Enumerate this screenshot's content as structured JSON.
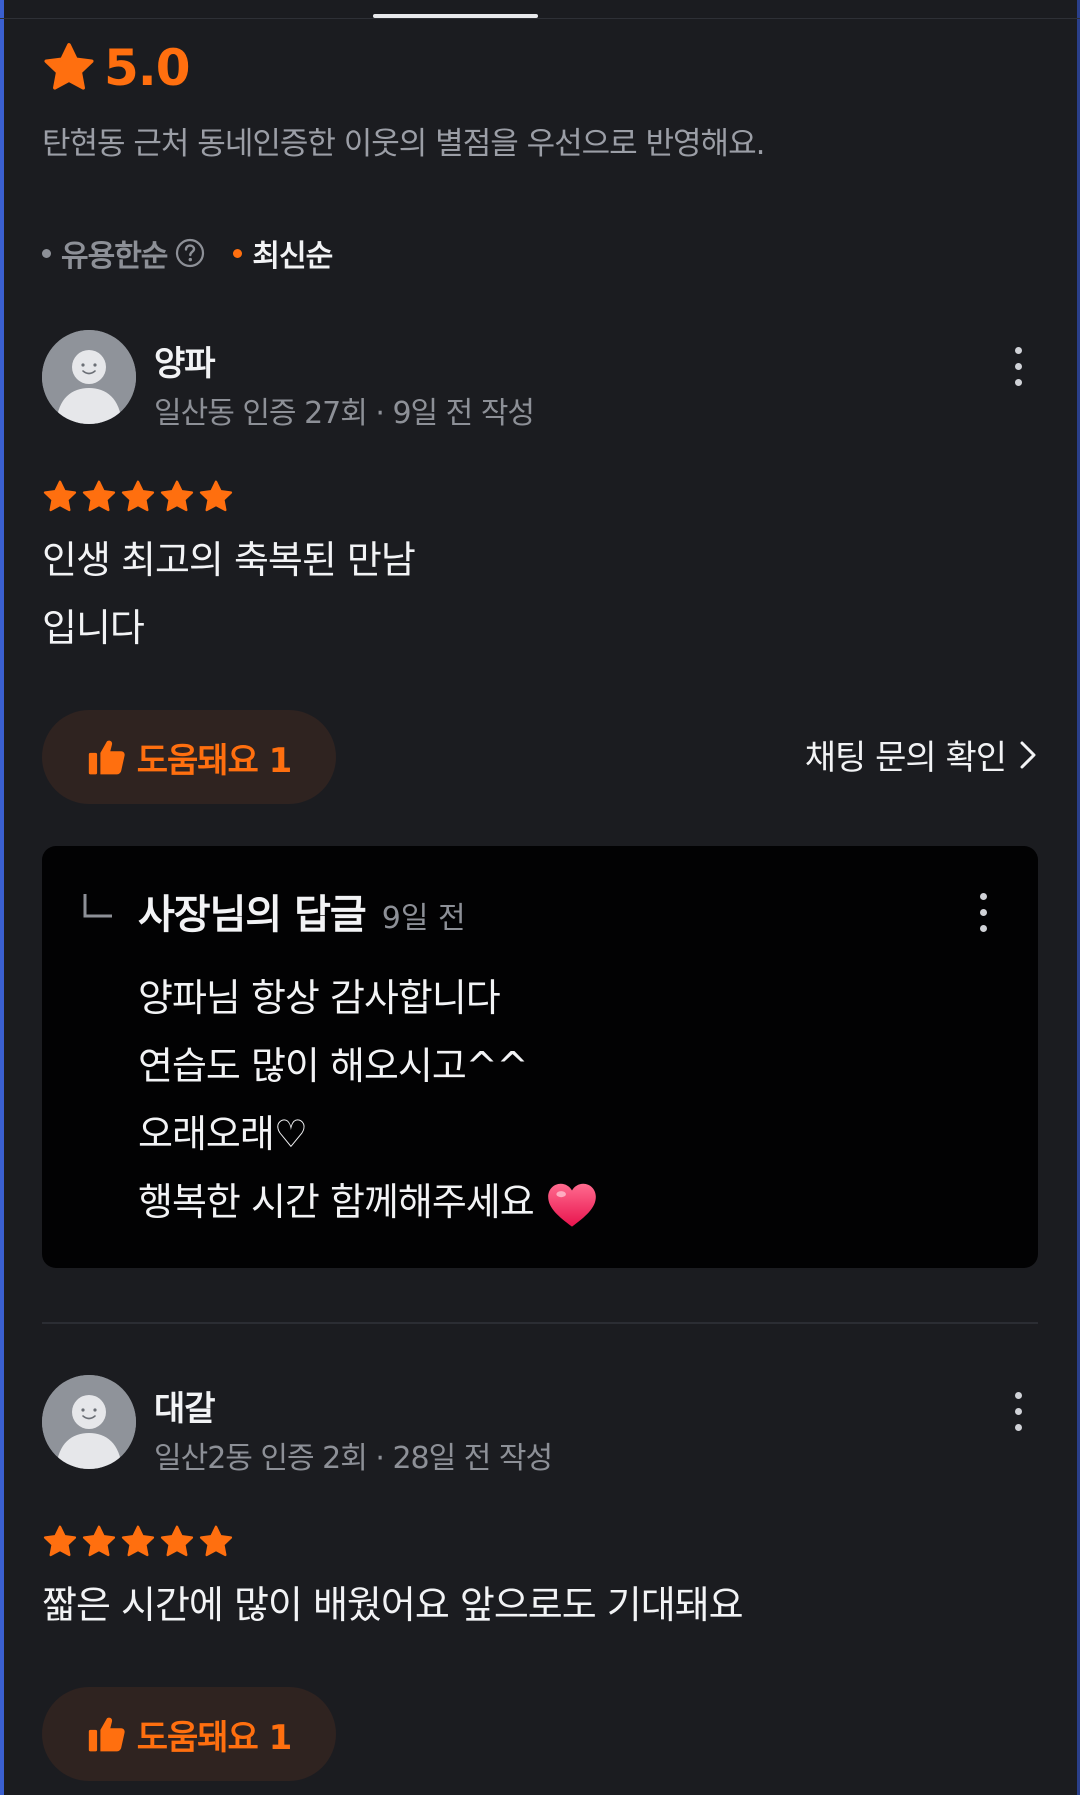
{
  "header": {
    "rating": "5.0",
    "description": "탄현동 근처 동네인증한 이웃의 별점을 우선으로 반영해요."
  },
  "sort": {
    "options": [
      {
        "label": "유용한순",
        "active": false
      },
      {
        "label": "최신순",
        "active": true
      }
    ]
  },
  "reviews": [
    {
      "user": "양파",
      "meta": "일산동 인증 27회 · 9일 전 작성",
      "stars": 5,
      "text": "인생 최고의 축복된 만남\n입니다",
      "helpful_label": "도움돼요 1",
      "chat_link": "채팅 문의 확인",
      "reply": {
        "title": "사장님의 답글",
        "time": "9일 전",
        "lines": [
          "양파님 항상 감사합니다",
          "연습도 많이 해오시고^^",
          "오래오래♡",
          "행복한 시간 함께해주세요"
        ]
      }
    },
    {
      "user": "대갈",
      "meta": "일산2동 인증 2회 · 28일 전 작성",
      "stars": 5,
      "text": "짧은 시간에 많이 배웠어요 앞으로도 기대돼요",
      "helpful_label": "도움돼요 1"
    }
  ],
  "colors": {
    "accent": "#ff6f0f",
    "background": "#1b1c20",
    "reply_background": "#020203",
    "muted_text": "#8d9097"
  },
  "icons": {
    "rating": "star-icon",
    "help": "question-circle-icon",
    "menu": "kebab-menu-icon",
    "helpful": "thumbs-up-icon",
    "chevron": "chevron-right-icon",
    "reply": "reply-corner-icon",
    "heart": "heart-icon",
    "avatar": "default-avatar-icon"
  }
}
